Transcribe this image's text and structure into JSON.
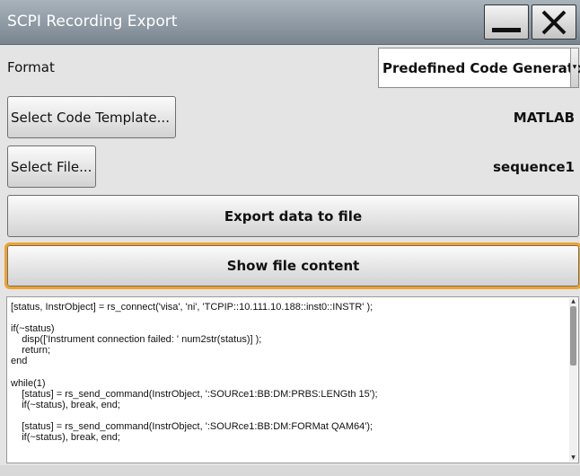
{
  "window": {
    "title": "SCPI Recording Export"
  },
  "format": {
    "label": "Format",
    "selected": "Predefined Code Generator"
  },
  "template": {
    "button_label": "Select Code Template...",
    "value": "MATLAB"
  },
  "file": {
    "button_label": "Select File...",
    "value": "sequence1"
  },
  "actions": {
    "export_label": "Export data to file",
    "show_label": "Show file content"
  },
  "code": {
    "lines": [
      "[status, InstrObject] = rs_connect('visa', 'ni', 'TCPIP::10.111.10.188::inst0::INSTR' );",
      "",
      "if(~status)",
      "    disp(['Instrument connection failed: ' num2str(status)] );",
      "    return;",
      "end",
      "",
      "while(1)",
      "    [status] = rs_send_command(InstrObject, ':SOURce1:BB:DM:PRBS:LENGth 15');",
      "    if(~status), break, end;",
      "",
      "    [status] = rs_send_command(InstrObject, ':SOURce1:BB:DM:FORMat QAM64');",
      "    if(~status), break, end;"
    ]
  },
  "colors": {
    "focus": "#f0a12a",
    "titlebar": "#8d98a2"
  }
}
